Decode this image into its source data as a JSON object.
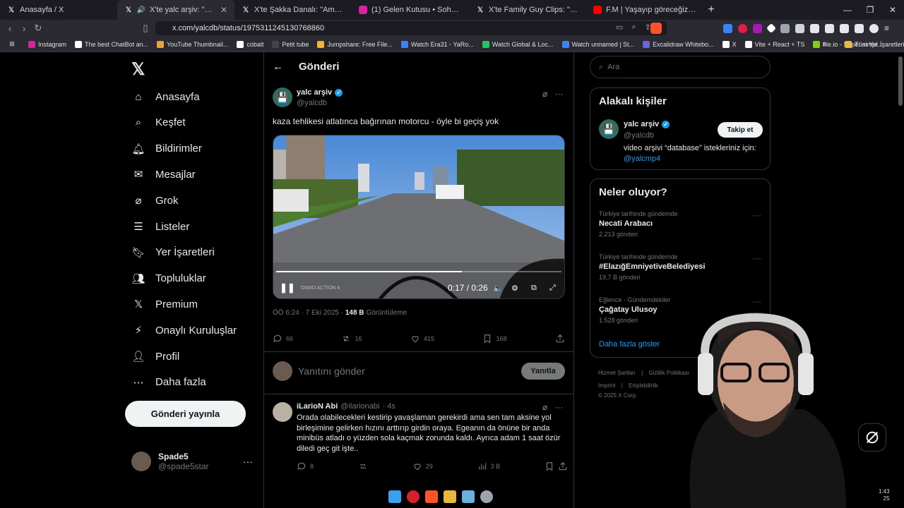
{
  "browser": {
    "tabs": [
      {
        "title": "Anasayfa / X",
        "icon": "x-icon",
        "active": false
      },
      {
        "title": "X'te yalc arşiv: \"kaza tehlikesi",
        "icon": "x-icon",
        "active": true
      },
      {
        "title": "X'te Şakka Danalı: \"Amerika'da doğsa",
        "icon": "x-icon",
        "active": false
      },
      {
        "title": "(1) Gelen Kutusu • Sohbetler",
        "icon": "instagram-icon",
        "active": false
      },
      {
        "title": "X'te Family Guy Clips: \"Not a good d",
        "icon": "x-icon",
        "active": false
      },
      {
        "title": "F.M | Yaşayıp göreceğiz - YouTube",
        "icon": "youtube-icon",
        "active": false
      }
    ],
    "url": "x.com/yalcdb/status/1975311245130768860",
    "bookmarks": [
      {
        "label": "Instagram",
        "color": "#d6249f"
      },
      {
        "label": "The best ChatBot an...",
        "color": "#ffffff"
      },
      {
        "label": "YouTube Thumbnail...",
        "color": "#e8a33d"
      },
      {
        "label": "cobalt",
        "color": "#ffffff"
      },
      {
        "label": "Petit tube",
        "color": "#444444"
      },
      {
        "label": "Jumpshare: Free File...",
        "color": "#f2b632"
      },
      {
        "label": "Watch Era31 - YaRo...",
        "color": "#3b82f6"
      },
      {
        "label": "Watch Global & Loc...",
        "color": "#22c55e"
      },
      {
        "label": "Watch unnamed | St...",
        "color": "#3b82f6"
      },
      {
        "label": "Excalidraw Whitebo...",
        "color": "#6965db"
      },
      {
        "label": "X",
        "color": "#ffffff"
      },
      {
        "label": "Vite + React + TS",
        "color": "#ffffff"
      },
      {
        "label": "file.io - Super simpl...",
        "color": "#84cc16"
      }
    ],
    "bookmarks_more": "»",
    "all_bookmarks": "Tüm Yer İşaretleri"
  },
  "sidebar": {
    "items": [
      {
        "label": "Anasayfa",
        "icon": "home-icon"
      },
      {
        "label": "Keşfet",
        "icon": "search-icon"
      },
      {
        "label": "Bildirimler",
        "icon": "bell-icon"
      },
      {
        "label": "Mesajlar",
        "icon": "mail-icon"
      },
      {
        "label": "Grok",
        "icon": "grok-icon"
      },
      {
        "label": "Listeler",
        "icon": "list-icon"
      },
      {
        "label": "Yer İşaretleri",
        "icon": "bookmark-icon"
      },
      {
        "label": "Topluluklar",
        "icon": "community-icon"
      },
      {
        "label": "Premium",
        "icon": "x-premium-icon"
      },
      {
        "label": "Onaylı Kuruluşlar",
        "icon": "lightning-icon"
      },
      {
        "label": "Profil",
        "icon": "profile-icon"
      },
      {
        "label": "Daha fazla",
        "icon": "more-circle-icon"
      }
    ],
    "post_button": "Gönderi yayınla",
    "user": {
      "name": "Spade5",
      "handle": "@spade5star"
    }
  },
  "main": {
    "header": "Gönderi",
    "tweet": {
      "name": "yalc arşiv",
      "handle": "@yalcdb",
      "text": "kaza tehlikesi atlatınca bağırınan motorcu - öyle bi geçiş yok",
      "video": {
        "watermark": "OSMO ACTION 4",
        "time": "0:17 / 0:26",
        "progress": 0.65
      },
      "timestamp": "ÖÖ 6:24 · 7 Eki 2025 ·",
      "views": "148 B",
      "views_label": "Görüntüleme",
      "stats": {
        "replies": "66",
        "reposts": "16",
        "likes": "415",
        "bookmarks": "168"
      }
    },
    "reply_box": {
      "placeholder": "Yanıtını gönder",
      "button": "Yanıtla"
    },
    "reply": {
      "name": "iLarioN Abi",
      "handle": "@ilarionabi",
      "time": "· 4s",
      "text": "Orada olabilecekleri kestirip yavaşlaman gerekirdi ama sen tam aksine yol birleşimine gelirken hızını arttırıp girdin oraya.  Egeanın da önüne bir anda minibüs atladı o yüzden sola kaçmak zorunda kaldı. Ayrıca adam 1 saat özür diledi geç git işte..",
      "stats": {
        "replies": "8",
        "likes": "29",
        "views": "3 B"
      }
    }
  },
  "right": {
    "search_placeholder": "Ara",
    "related": {
      "title": "Alakalı kişiler",
      "name": "yalc arşiv",
      "handle": "@yalcdb",
      "follow": "Takip et",
      "bio": "video arşivi “database” istekleriniz için:",
      "bio_link": "@yalcmp4"
    },
    "trends": {
      "title": "Neler oluyor?",
      "items": [
        {
          "context": "Türkiye tarihinde gündemde",
          "topic": "Necati Arabacı",
          "count": "2.213 gönderi"
        },
        {
          "context": "Türkiye tarihinde gündemde",
          "topic": "#ElazığEmniyetiveBelediyesi",
          "count": "19,7 B gönderi"
        },
        {
          "context": "Eğlence · Gündemdekiler",
          "topic": "Çağatay Ulusoy",
          "count": "1.528 gönderi"
        }
      ],
      "show_more": "Daha fazla göster"
    },
    "footer": {
      "line1": [
        "Hizmet Şartları",
        "Gizlilik Politikası"
      ],
      "line2": [
        "Imprint",
        "Erişilebilirlik"
      ],
      "copyright": "© 2025 X Corp."
    }
  },
  "system": {
    "clock_line1": "1:43",
    "clock_line2": "25"
  }
}
